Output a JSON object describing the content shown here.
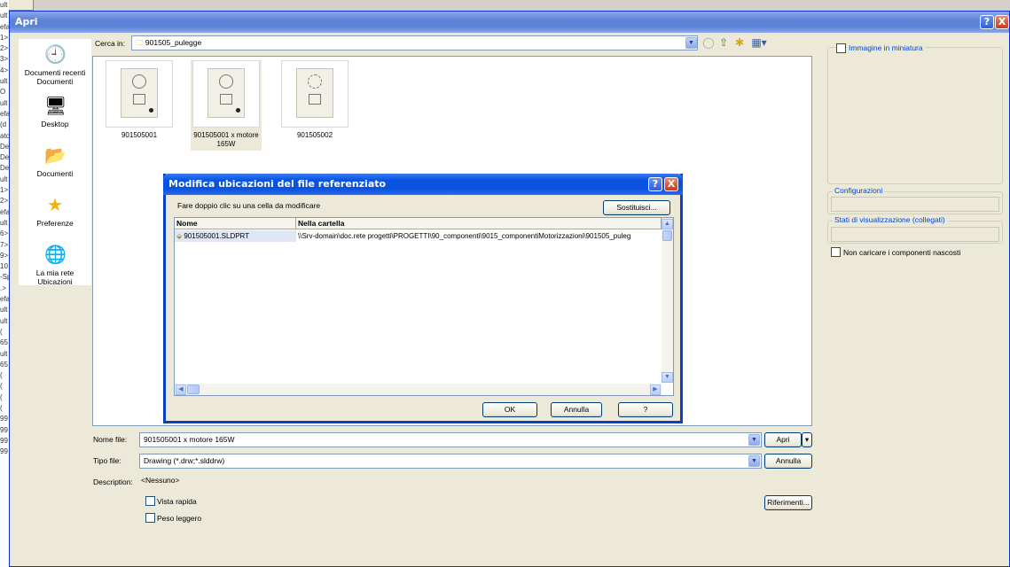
{
  "background_strip": [
    "ult",
    "ult",
    "efa",
    "1>",
    "2>",
    "3>",
    "4>",
    "ult",
    "O",
    "ult",
    "efa",
    "(d",
    "ato",
    "Def",
    "Def",
    "Def",
    "ult",
    "1>",
    "2>",
    "efa",
    "ult",
    "6>",
    "7>",
    "9>",
    "10",
    "-Sp",
    ".>",
    "efa",
    "ult",
    "ult",
    "(",
    "65",
    "ult",
    "65",
    "(",
    "(",
    "(",
    "(",
    "99",
    "99",
    "99",
    "99"
  ],
  "main_window": {
    "title": "Apri",
    "help": "?",
    "close": "X"
  },
  "places": [
    {
      "label": "Documenti recenti Documenti",
      "icon": "recent-documents-icon"
    },
    {
      "label": "Desktop",
      "icon": "desktop-icon"
    },
    {
      "label": "Documenti",
      "icon": "my-documents-icon"
    },
    {
      "label": "Preferenze",
      "icon": "favorites-star-icon"
    },
    {
      "label": "La mia rete Ubicazioni",
      "icon": "network-places-icon"
    }
  ],
  "look_in": {
    "label": "Cerca in:",
    "value": "901505_pulegge"
  },
  "files": [
    {
      "name": "901505001"
    },
    {
      "name": "901505001 x motore 165W"
    },
    {
      "name": "901505002"
    }
  ],
  "bottom": {
    "filename_label": "Nome file:",
    "filename_value": "901505001 x motore 165W",
    "filetype_label": "Tipo file:",
    "filetype_value": "Drawing (*.drw;*.slddrw)",
    "description_label": "Description:",
    "description_value": "<Nessuno>",
    "open_button": "Apri",
    "cancel_button": "Annulla",
    "quick_view": "Vista rapida",
    "lightweight": "Peso leggero",
    "references_button": "Riferimenti..."
  },
  "right_panel": {
    "thumbnail": "Immagine in miniatura",
    "configurations": "Configurazioni",
    "display_states": "Stati di visualizzazione (collegati)",
    "no_hidden": "Non caricare i componenti nascosti"
  },
  "modal": {
    "title": "Modifica ubicazioni del file referenziato",
    "help": "?",
    "close": "X",
    "instruction": "Fare doppio clic su una cella da modificare",
    "replace_button": "Sostituisci...",
    "columns": [
      "Nome",
      "Nella cartella"
    ],
    "row": {
      "name": "901505001.SLDPRT",
      "folder": "\\\\Srv-domain\\doc.rete progetti\\PROGETTI\\90_componenti\\9015_componentiMotorizzazioni\\901505_puleg"
    },
    "ok_button": "OK",
    "cancel_button": "Annulla",
    "help_button": "?"
  }
}
